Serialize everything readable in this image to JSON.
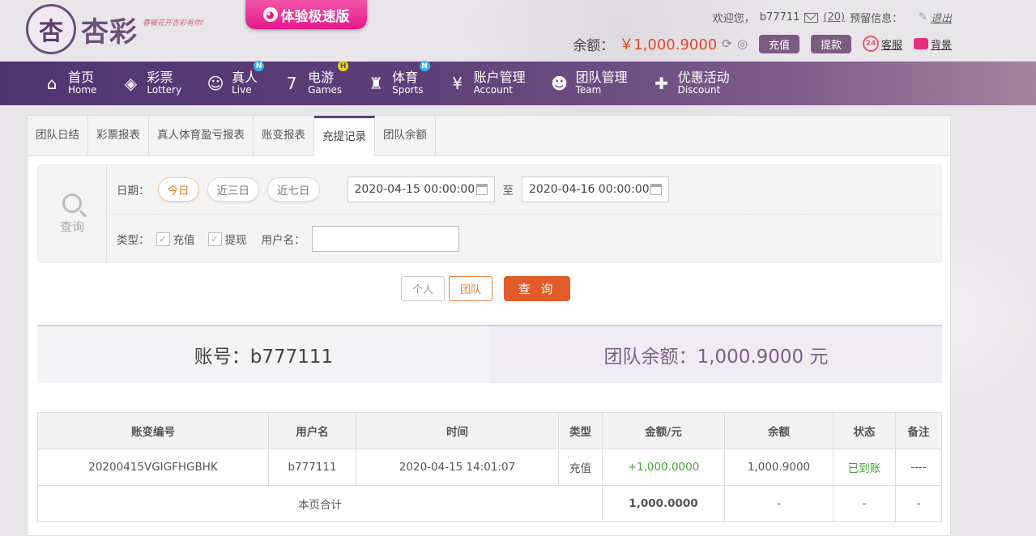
{
  "header": {
    "logo_char": "杏",
    "logo_text": "杏彩",
    "slogan": "春暖花开杏彩有你!",
    "speed_label": "体验极速版",
    "welcome": "欢迎您，",
    "username": "b77711",
    "mail_count": "(20)",
    "preset_info": "预留信息：",
    "logout": "退出",
    "balance_label": "余额：",
    "balance": "￥1,000.9000",
    "deposit": "充值",
    "withdraw": "提款",
    "service": "客服",
    "service_num": "24",
    "background": "背景"
  },
  "nav": [
    {
      "l1": "首页",
      "l2": "Home",
      "icon": "home-icon",
      "glyph": "⌂",
      "badge": ""
    },
    {
      "l1": "彩票",
      "l2": "Lottery",
      "icon": "lottery-icon",
      "glyph": "◈",
      "badge": ""
    },
    {
      "l1": "真人",
      "l2": "Live",
      "icon": "live-icon",
      "glyph": "☺",
      "badge": "N"
    },
    {
      "l1": "电游",
      "l2": "Games",
      "icon": "games-icon",
      "glyph": "7",
      "badge": "H"
    },
    {
      "l1": "体育",
      "l2": "Sports",
      "icon": "trophy-icon",
      "glyph": "♜",
      "badge": "N"
    },
    {
      "l1": "账户管理",
      "l2": "Account",
      "icon": "account-icon",
      "glyph": "¥",
      "badge": ""
    },
    {
      "l1": "团队管理",
      "l2": "Team",
      "icon": "team-icon",
      "glyph": "☻",
      "badge": ""
    },
    {
      "l1": "优惠活动",
      "l2": "Discount",
      "icon": "gift-icon",
      "glyph": "✚",
      "badge": ""
    }
  ],
  "tabs": [
    "团队日结",
    "彩票报表",
    "真人体育盈亏报表",
    "账变报表",
    "充提记录",
    "团队余额"
  ],
  "filter": {
    "query_label": "查询",
    "date_label": "日期：",
    "today": "今日",
    "three_days": "近三日",
    "seven_days": "近七日",
    "start": "2020-04-15 00:00:00",
    "to": "至",
    "end": "2020-04-16 00:00:00",
    "type_label": "类型：",
    "deposit": "充值",
    "withdraw": "提现",
    "user_label": "用户名："
  },
  "buttons": {
    "personal": "个人",
    "team": "团队",
    "search": "查 询"
  },
  "account": {
    "account_text": "账号：b777111",
    "team_balance": "团队余额：1,000.9000 元"
  },
  "table": {
    "headers": [
      "账变编号",
      "用户名",
      "时间",
      "类型",
      "金额/元",
      "余额",
      "状态",
      "备注"
    ],
    "rows": [
      [
        "20200415VGIGFHGBHK",
        "b777111",
        "2020-04-15 14:01:07",
        "充值",
        "+1,000.0000",
        "1,000.9000",
        "已到账",
        "----"
      ]
    ],
    "total": {
      "label": "本页合计",
      "amount": "1,000.0000",
      "c1": "-",
      "c2": "-",
      "c3": "-"
    }
  },
  "colors": {
    "primary": "#5d3f79",
    "accent": "#e25b28",
    "money": "#e0492e",
    "success": "#49a13b"
  }
}
